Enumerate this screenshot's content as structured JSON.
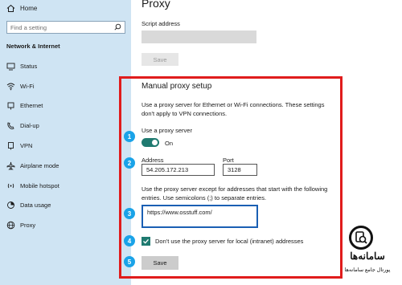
{
  "sidebar": {
    "home": "Home",
    "search_placeholder": "Find a setting",
    "section_title": "Network & Internet",
    "items": [
      {
        "label": "Status",
        "icon": "status-icon"
      },
      {
        "label": "Wi-Fi",
        "icon": "wifi-icon"
      },
      {
        "label": "Ethernet",
        "icon": "ethernet-icon"
      },
      {
        "label": "Dial-up",
        "icon": "dialup-icon"
      },
      {
        "label": "VPN",
        "icon": "vpn-icon"
      },
      {
        "label": "Airplane mode",
        "icon": "airplane-icon"
      },
      {
        "label": "Mobile hotspot",
        "icon": "hotspot-icon"
      },
      {
        "label": "Data usage",
        "icon": "data-usage-icon"
      },
      {
        "label": "Proxy",
        "icon": "globe-icon"
      }
    ]
  },
  "main": {
    "title": "Proxy",
    "script_address_label": "Script address",
    "script_save_label": "Save",
    "manual": {
      "title": "Manual proxy setup",
      "description": "Use a proxy server for Ethernet or Wi-Fi connections. These settings don't apply to VPN connections.",
      "use_proxy_label": "Use a proxy server",
      "toggle_state": "On",
      "address_label": "Address",
      "address_value": "54.205.172.213",
      "port_label": "Port",
      "port_value": "3128",
      "exceptions_description": "Use the proxy server except for addresses that start with the following entries. Use semicolons (;) to separate entries.",
      "exceptions_value": "https://www.osstuff.com/",
      "local_checkbox_label": "Don't use the proxy server for local (intranet) addresses",
      "local_checkbox_checked": true,
      "save_label": "Save"
    }
  },
  "step_badges": [
    "1",
    "2",
    "3",
    "4",
    "5"
  ],
  "watermark": {
    "title": "سامانه‌ها",
    "subtitle": "پورتال جامع سامانه‌ها"
  },
  "colors": {
    "sidebar_bg": "#cfe4f3",
    "accent": "#1f7a70",
    "highlight": "#e01c1c",
    "badge": "#1aa3e8"
  }
}
